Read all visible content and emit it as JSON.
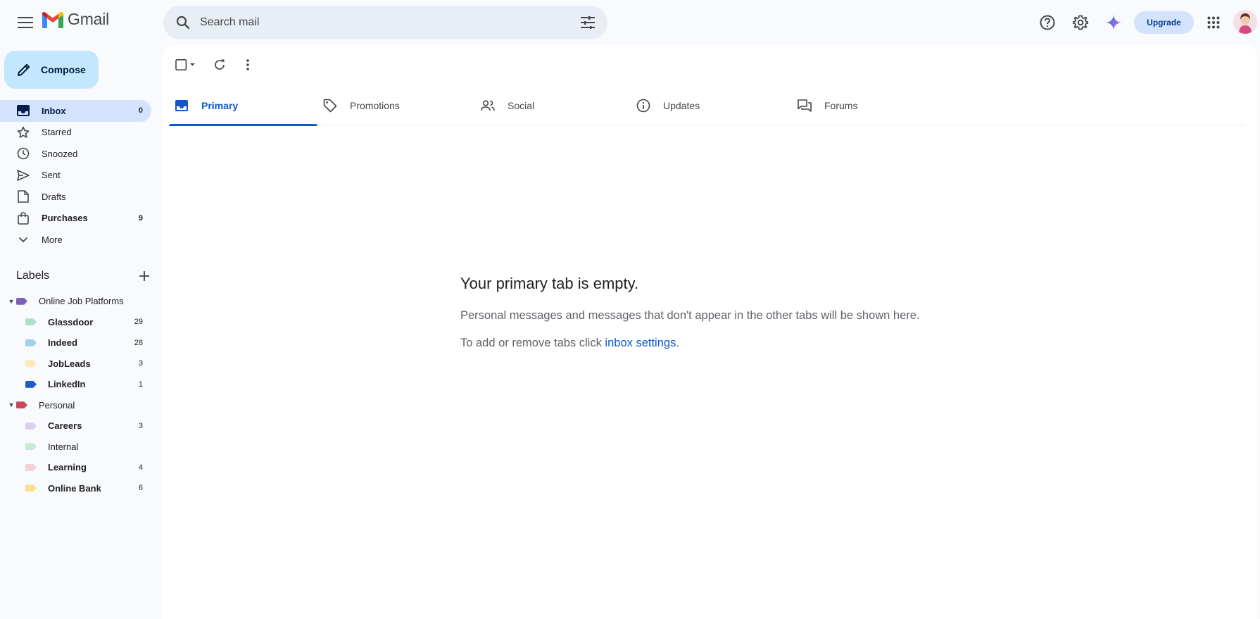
{
  "app": {
    "name": "Gmail"
  },
  "search": {
    "placeholder": "Search mail"
  },
  "header": {
    "upgrade_label": "Upgrade"
  },
  "compose": {
    "label": "Compose"
  },
  "nav": {
    "inbox": {
      "label": "Inbox",
      "count": "0"
    },
    "starred": {
      "label": "Starred"
    },
    "snoozed": {
      "label": "Snoozed"
    },
    "sent": {
      "label": "Sent"
    },
    "drafts": {
      "label": "Drafts"
    },
    "purchases": {
      "label": "Purchases",
      "count": "9"
    },
    "more": {
      "label": "More"
    }
  },
  "labels": {
    "title": "Labels",
    "online_job_platforms": {
      "name": "Online Job Platforms",
      "color": "#7b61b8"
    },
    "glassdoor": {
      "name": "Glassdoor",
      "count": "29",
      "color": "#a8e2c8"
    },
    "indeed": {
      "name": "Indeed",
      "count": "28",
      "color": "#9fd0ee"
    },
    "jobleads": {
      "name": "JobLeads",
      "count": "3",
      "color": "#fde9b8"
    },
    "linkedin": {
      "name": "LinkedIn",
      "count": "1",
      "color": "#1c5cc4"
    },
    "personal": {
      "name": "Personal",
      "color": "#c9485b"
    },
    "careers": {
      "name": "Careers",
      "count": "3",
      "color": "#dcd0f2"
    },
    "internal": {
      "name": "Internal",
      "color": "#c5ebd5"
    },
    "learning": {
      "name": "Learning",
      "count": "4",
      "color": "#f5cfd4"
    },
    "online_bank": {
      "name": "Online Bank",
      "count": "6",
      "color": "#fbdf8e"
    }
  },
  "tabs": {
    "primary": "Primary",
    "promotions": "Promotions",
    "social": "Social",
    "updates": "Updates",
    "forums": "Forums"
  },
  "empty": {
    "title": "Your primary tab is empty.",
    "line1": "Personal messages and messages that don't appear in the other tabs will be shown here.",
    "line2_prefix": "To add or remove tabs click ",
    "line2_link": "inbox settings",
    "line2_suffix": "."
  },
  "colors": {
    "accent": "#0b57d0",
    "compose_bg": "#c2e7ff",
    "active_nav_bg": "#d3e3fd"
  },
  "icons": [
    "menu-icon",
    "gmail-logo-icon",
    "search-icon",
    "tune-icon",
    "help-icon",
    "settings-icon",
    "gemini-icon",
    "apps-icon",
    "pencil-icon",
    "inbox-icon",
    "star-icon",
    "clock-icon",
    "send-icon",
    "draft-icon",
    "purchases-icon",
    "chevron-down-icon",
    "plus-icon",
    "checkbox-icon",
    "refresh-icon",
    "more-vert-icon",
    "tag-icon",
    "people-icon",
    "info-icon",
    "forum-icon"
  ]
}
